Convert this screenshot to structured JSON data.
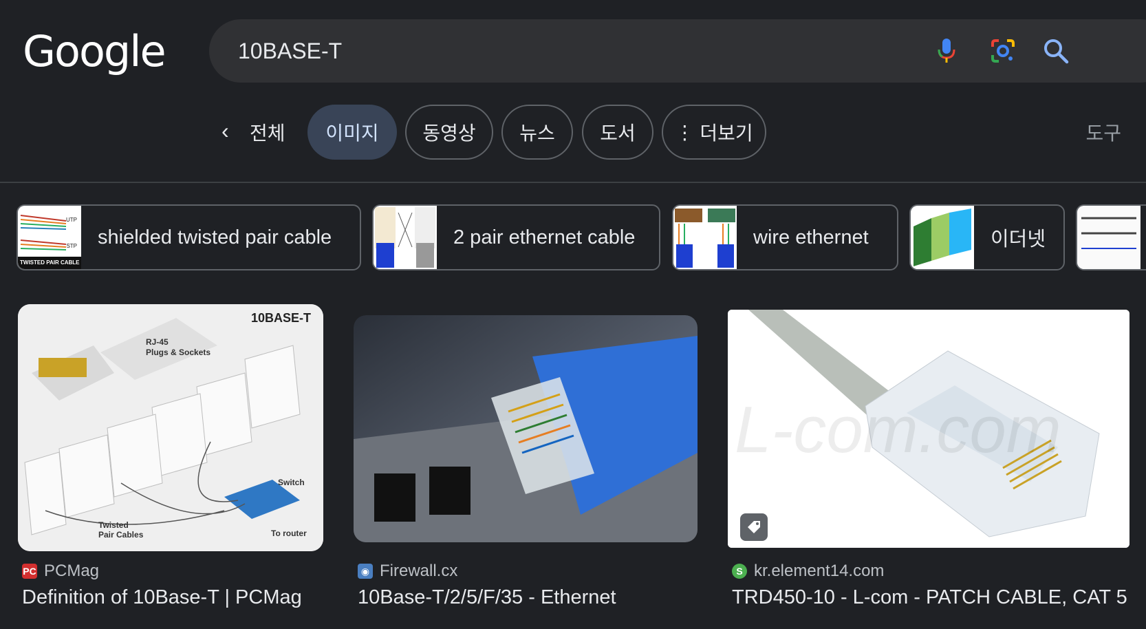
{
  "header": {
    "logo": "Google",
    "search": {
      "value": "10BASE-T"
    },
    "icons": [
      "microphone-icon",
      "lens-icon",
      "search-icon"
    ]
  },
  "tabs": {
    "back_icon": "‹",
    "all": "전체",
    "items": [
      {
        "label": "이미지",
        "active": true
      },
      {
        "label": "동영상",
        "active": false
      },
      {
        "label": "뉴스",
        "active": false
      },
      {
        "label": "도서",
        "active": false
      },
      {
        "label": "더보기",
        "active": false
      }
    ],
    "tools": "도구"
  },
  "chips": [
    {
      "label": "shielded twisted pair cable",
      "thumb_text": [
        "UTP",
        "STP",
        "TWISTED PAIR CABLE"
      ]
    },
    {
      "label": "2 pair ethernet cable"
    },
    {
      "label": "wire ethernet"
    },
    {
      "label": "이더넷"
    }
  ],
  "results": [
    {
      "source": "PCMag",
      "title": "Definition of 10Base-T | PCMag",
      "image_text": [
        "10BASE-T",
        "RJ-45",
        "Plugs & Sockets",
        "Switch",
        "Twisted",
        "Pair Cables",
        "To router"
      ]
    },
    {
      "source": "Firewall.cx",
      "title": "10Base-T/2/5/F/35 - Ethernet"
    },
    {
      "source": "kr.element14.com",
      "title": "TRD450-10 - L-com - PATCH CABLE, CAT 5 ...",
      "watermark": "L-com.com"
    }
  ],
  "colors": {
    "background": "#1f2125",
    "search_bg": "#303134",
    "active_tab": "#394457",
    "border": "#5f6368"
  }
}
